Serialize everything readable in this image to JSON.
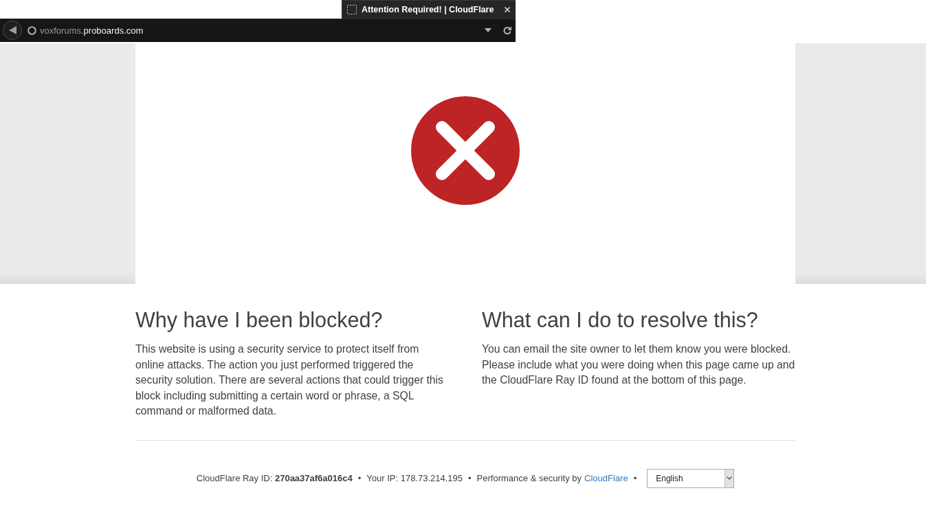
{
  "browser": {
    "tab": {
      "title": "Attention Required! | CloudFlare"
    },
    "address_bar": {
      "url_parts": [
        {
          "text": "voxforums.",
          "dim": true
        },
        {
          "text": "proboards.com",
          "dim": false
        }
      ]
    }
  },
  "sections": [
    {
      "heading": "Why have I been blocked?",
      "text": "This website is using a security service to protect itself from online attacks. The action you just performed triggered the security solution. There are several actions that could trigger this block including submitting a certain word or phrase, a SQL command or malformed data."
    },
    {
      "heading": "What can I do to resolve this?",
      "text": "You can email the site owner to let them know you were blocked. Please include what you were doing when this page came up and the CloudFlare Ray ID found at the bottom of this page."
    }
  ],
  "footer": {
    "items": [
      {
        "kind": "text",
        "text": "CloudFlare Ray ID: **270aa37af6a016c4**"
      },
      {
        "kind": "separator",
        "text": "•"
      },
      {
        "kind": "text",
        "text": "Your IP: 178.73.214.195"
      },
      {
        "kind": "separator",
        "text": "•"
      },
      {
        "kind": "text",
        "text": "Performance & security by"
      },
      {
        "kind": "link",
        "text": "CloudFlare"
      },
      {
        "kind": "separator",
        "text": "•"
      },
      {
        "kind": "select",
        "value": "English"
      }
    ]
  }
}
